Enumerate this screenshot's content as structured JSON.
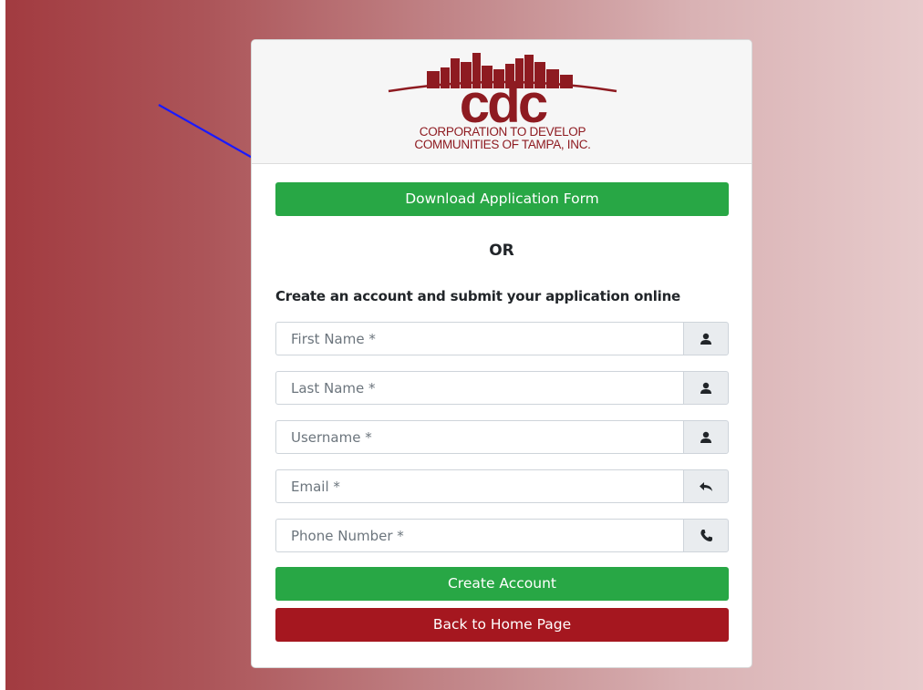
{
  "logo": {
    "brand": "cdc",
    "tagline_line1": "CORPORATION TO DEVELOP",
    "tagline_line2": "COMMUNITIES OF TAMPA, INC.",
    "brand_color": "#8e1b21"
  },
  "download_button": {
    "label": "Download Application Form"
  },
  "divider": {
    "label": "OR"
  },
  "create_prompt": {
    "label": "Create an account and submit your application online"
  },
  "form": {
    "first_name": {
      "placeholder": "First Name *",
      "value": "",
      "icon": "user-icon"
    },
    "last_name": {
      "placeholder": "Last Name *",
      "value": "",
      "icon": "user-icon"
    },
    "username": {
      "placeholder": "Username *",
      "value": "",
      "icon": "user-icon"
    },
    "email": {
      "placeholder": "Email *",
      "value": "",
      "icon": "reply-icon"
    },
    "phone": {
      "placeholder": "Phone Number *",
      "value": "",
      "icon": "phone-icon"
    }
  },
  "create_button": {
    "label": "Create Account"
  },
  "home_button": {
    "label": "Back to Home Page"
  },
  "colors": {
    "primary_green": "#28a745",
    "back_red": "#a5171f",
    "annotation_arrow": "#1a1aff"
  }
}
